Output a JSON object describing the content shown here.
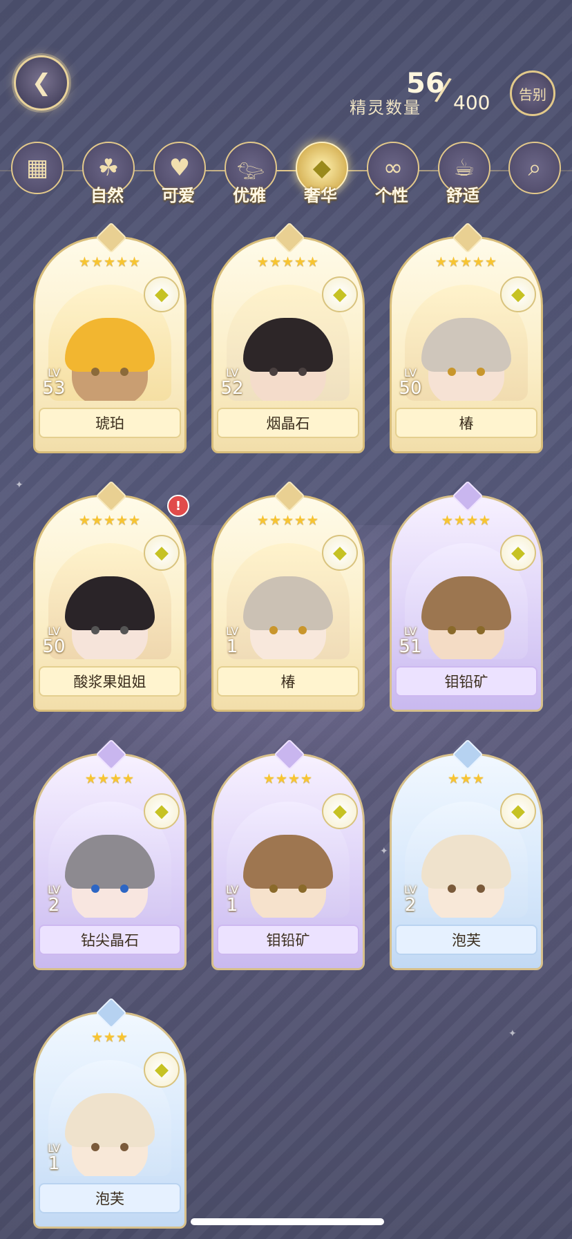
{
  "header": {
    "count_label": "精灵数量",
    "count_current": "56",
    "count_max": "400",
    "farewell_label": "告别"
  },
  "filters": [
    {
      "label": "",
      "icon": "grid-icon"
    },
    {
      "label": "自然",
      "icon": "clover-icon"
    },
    {
      "label": "可爱",
      "icon": "heart-icon"
    },
    {
      "label": "优雅",
      "icon": "swan-icon"
    },
    {
      "label": "奢华",
      "icon": "diamond-icon",
      "active": true
    },
    {
      "label": "个性",
      "icon": "glasses-icon"
    },
    {
      "label": "舒适",
      "icon": "teacup-icon"
    },
    {
      "label": "",
      "icon": "search-icon"
    }
  ],
  "cards": [
    {
      "name": "琥珀",
      "lv_label": "LV",
      "level": "53",
      "stars": 5,
      "rarity": "gold"
    },
    {
      "name": "烟晶石",
      "lv_label": "LV",
      "level": "52",
      "stars": 5,
      "rarity": "gold"
    },
    {
      "name": "椿",
      "lv_label": "LV",
      "level": "50",
      "stars": 5,
      "rarity": "gold"
    },
    {
      "name": "酸浆果姐姐",
      "lv_label": "LV",
      "level": "50",
      "stars": 5,
      "rarity": "gold",
      "alert": "!"
    },
    {
      "name": "椿",
      "lv_label": "LV",
      "level": "1",
      "stars": 5,
      "rarity": "gold"
    },
    {
      "name": "钼铅矿",
      "lv_label": "LV",
      "level": "51",
      "stars": 4,
      "rarity": "purple"
    },
    {
      "name": "钻尖晶石",
      "lv_label": "LV",
      "level": "2",
      "stars": 4,
      "rarity": "purple"
    },
    {
      "name": "钼铅矿",
      "lv_label": "LV",
      "level": "1",
      "stars": 4,
      "rarity": "purple"
    },
    {
      "name": "泡芙",
      "lv_label": "LV",
      "level": "2",
      "stars": 3,
      "rarity": "blue"
    },
    {
      "name": "泡芙",
      "lv_label": "LV",
      "level": "1",
      "stars": 3,
      "rarity": "blue"
    }
  ],
  "colors": {
    "gold_frame": "#d8bd7a",
    "star": "#f7c431",
    "alert": "#e14b4b"
  }
}
